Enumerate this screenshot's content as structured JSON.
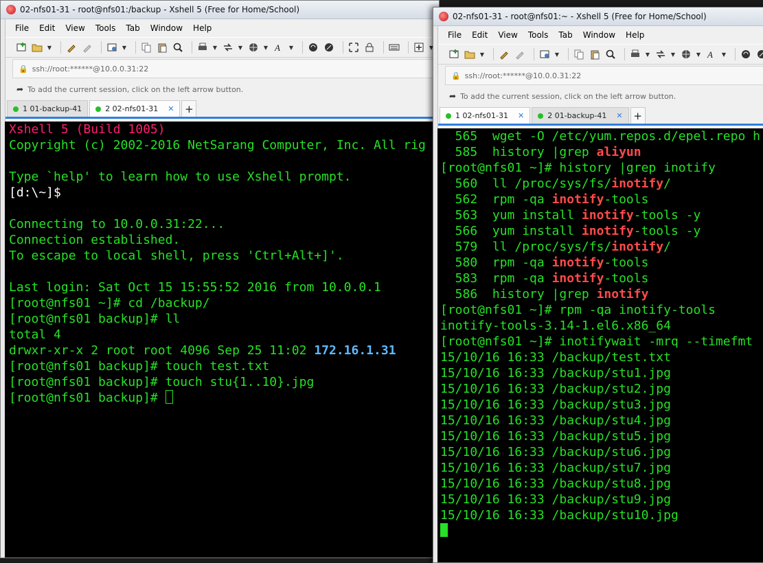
{
  "windows": [
    {
      "title": "02-nfs01-31 - root@nfs01:/backup - Xshell 5 (Free for Home/School)",
      "menu": [
        "File",
        "Edit",
        "View",
        "Tools",
        "Tab",
        "Window",
        "Help"
      ],
      "address": "ssh://root:******@10.0.0.31:22",
      "hint": "To add the current session, click on the left arrow button.",
      "tabs": [
        {
          "label": "1 01-backup-41",
          "active": false
        },
        {
          "label": "2 02-nfs01-31",
          "active": true
        }
      ],
      "lines": [
        {
          "segs": [
            {
              "t": "Xshell 5 (Build 1005)",
              "c": "magenta"
            }
          ]
        },
        {
          "segs": [
            {
              "t": "Copyright (c) 2002-2016 NetSarang Computer, Inc. All rig"
            }
          ]
        },
        {
          "segs": [
            {
              "t": ""
            }
          ]
        },
        {
          "segs": [
            {
              "t": "Type `help' to learn how to use Xshell prompt."
            }
          ]
        },
        {
          "segs": [
            {
              "t": "[d:\\~]$",
              "c": "white"
            }
          ]
        },
        {
          "segs": [
            {
              "t": ""
            }
          ]
        },
        {
          "segs": [
            {
              "t": "Connecting to 10.0.0.31:22..."
            }
          ]
        },
        {
          "segs": [
            {
              "t": "Connection established."
            }
          ]
        },
        {
          "segs": [
            {
              "t": "To escape to local shell, press 'Ctrl+Alt+]'."
            }
          ]
        },
        {
          "segs": [
            {
              "t": ""
            }
          ]
        },
        {
          "segs": [
            {
              "t": "Last login: Sat Oct 15 15:55:52 2016 from 10.0.0.1"
            }
          ]
        },
        {
          "segs": [
            {
              "t": "[root@nfs01 ~]# cd /backup/"
            }
          ]
        },
        {
          "segs": [
            {
              "t": "[root@nfs01 backup]# ll"
            }
          ]
        },
        {
          "segs": [
            {
              "t": "total 4"
            }
          ]
        },
        {
          "segs": [
            {
              "t": "drwxr-xr-x 2 root root 4096 Sep 25 11:02 "
            },
            {
              "t": "172.16.1.31",
              "c": "blue"
            }
          ]
        },
        {
          "segs": [
            {
              "t": "[root@nfs01 backup]# touch test.txt"
            }
          ]
        },
        {
          "segs": [
            {
              "t": "[root@nfs01 backup]# touch stu{1..10}.jpg"
            }
          ]
        },
        {
          "segs": [
            {
              "t": "[root@nfs01 backup]# "
            }
          ],
          "cursor": "hollow"
        }
      ]
    },
    {
      "title": "02-nfs01-31 - root@nfs01:~ - Xshell 5 (Free for Home/School)",
      "menu": [
        "File",
        "Edit",
        "View",
        "Tools",
        "Tab",
        "Window",
        "Help"
      ],
      "address": "ssh://root:******@10.0.0.31:22",
      "hint": "To add the current session, click on the left arrow button.",
      "tabs": [
        {
          "label": "1 02-nfs01-31",
          "active": true
        },
        {
          "label": "2 01-backup-41",
          "active": false
        }
      ],
      "lines": [
        {
          "segs": [
            {
              "t": "  565  wget -O /etc/yum.repos.d/epel.repo h"
            }
          ]
        },
        {
          "segs": [
            {
              "t": "  585  history |grep "
            },
            {
              "t": "aliyun",
              "c": "red"
            }
          ]
        },
        {
          "segs": [
            {
              "t": "[root@nfs01 ~]# history |grep inotify"
            }
          ]
        },
        {
          "segs": [
            {
              "t": "  560  ll /proc/sys/fs/"
            },
            {
              "t": "inotify",
              "c": "red"
            },
            {
              "t": "/"
            }
          ]
        },
        {
          "segs": [
            {
              "t": "  562  rpm -qa "
            },
            {
              "t": "inotify",
              "c": "red"
            },
            {
              "t": "-tools"
            }
          ]
        },
        {
          "segs": [
            {
              "t": "  563  yum install "
            },
            {
              "t": "inotify",
              "c": "red"
            },
            {
              "t": "-tools -y"
            }
          ]
        },
        {
          "segs": [
            {
              "t": "  566  yum install "
            },
            {
              "t": "inotify",
              "c": "red"
            },
            {
              "t": "-tools -y"
            }
          ]
        },
        {
          "segs": [
            {
              "t": "  579  ll /proc/sys/fs/"
            },
            {
              "t": "inotify",
              "c": "red"
            },
            {
              "t": "/"
            }
          ]
        },
        {
          "segs": [
            {
              "t": "  580  rpm -qa "
            },
            {
              "t": "inotify",
              "c": "red"
            },
            {
              "t": "-tools"
            }
          ]
        },
        {
          "segs": [
            {
              "t": "  583  rpm -qa "
            },
            {
              "t": "inotify",
              "c": "red"
            },
            {
              "t": "-tools"
            }
          ]
        },
        {
          "segs": [
            {
              "t": "  586  history |grep "
            },
            {
              "t": "inotify",
              "c": "red"
            }
          ]
        },
        {
          "segs": [
            {
              "t": "[root@nfs01 ~]# rpm -qa inotify-tools"
            }
          ]
        },
        {
          "segs": [
            {
              "t": "inotify-tools-3.14-1.el6.x86_64"
            }
          ]
        },
        {
          "segs": [
            {
              "t": "[root@nfs01 ~]# inotifywait -mrq --timefmt"
            }
          ]
        },
        {
          "segs": [
            {
              "t": "15/10/16 16:33 /backup/test.txt"
            }
          ]
        },
        {
          "segs": [
            {
              "t": "15/10/16 16:33 /backup/stu1.jpg"
            }
          ]
        },
        {
          "segs": [
            {
              "t": "15/10/16 16:33 /backup/stu2.jpg"
            }
          ]
        },
        {
          "segs": [
            {
              "t": "15/10/16 16:33 /backup/stu3.jpg"
            }
          ]
        },
        {
          "segs": [
            {
              "t": "15/10/16 16:33 /backup/stu4.jpg"
            }
          ]
        },
        {
          "segs": [
            {
              "t": "15/10/16 16:33 /backup/stu5.jpg"
            }
          ]
        },
        {
          "segs": [
            {
              "t": "15/10/16 16:33 /backup/stu6.jpg"
            }
          ]
        },
        {
          "segs": [
            {
              "t": "15/10/16 16:33 /backup/stu7.jpg"
            }
          ]
        },
        {
          "segs": [
            {
              "t": "15/10/16 16:33 /backup/stu8.jpg"
            }
          ]
        },
        {
          "segs": [
            {
              "t": "15/10/16 16:33 /backup/stu9.jpg"
            }
          ]
        },
        {
          "segs": [
            {
              "t": "15/10/16 16:33 /backup/stu10.jpg"
            }
          ]
        },
        {
          "segs": [
            {
              "t": ""
            }
          ],
          "cursor": "solid"
        }
      ]
    }
  ],
  "toolbar_icons": [
    "new-session-icon",
    "open-folder-icon",
    "reconnect-icon",
    "disconnect-icon",
    "properties-icon",
    "copy-icon",
    "paste-icon",
    "find-icon",
    "print-icon",
    "transfer-icon",
    "globe-icon",
    "font-icon",
    "xftp-icon",
    "compose-icon",
    "fullscreen-icon",
    "lock-icon",
    "keyboard-icon",
    "add-icon"
  ],
  "colors": {
    "terminal_bg": "#000000",
    "terminal_fg": "#27e027",
    "highlight_red": "#ff4a4a",
    "banner_magenta": "#ff1e6e",
    "dir_blue": "#5fbaff",
    "tab_accent": "#2f7fdc"
  }
}
